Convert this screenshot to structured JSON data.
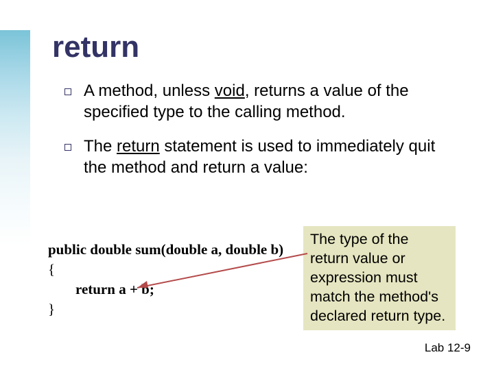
{
  "title": "return",
  "bullets": [
    {
      "html": "A method, unless <span class='u'>void</span>, returns a value of the specified type to the calling method."
    },
    {
      "html": "The <span class='u'>return</span> statement is used to immediately quit the method and return a value:"
    }
  ],
  "code": {
    "l1_pre": "public ",
    "l1_kw1": "double",
    "l1_sum": " sum(",
    "l1_kw2": "double",
    "l1_a": " a, ",
    "l1_kw3": "double",
    "l1_post": " b)",
    "l2": "{",
    "l3_kw": "return",
    "l3_rest": " a + b;",
    "l4": "}"
  },
  "annotation": "The type of the return value or expression must match the method's declared return type.",
  "footer": "Lab 12-9",
  "colors": {
    "titleColor": "#333366",
    "bulletBorder": "#333366",
    "annotationBg": "#e5e5c1",
    "arrow": "#b44a4a"
  }
}
